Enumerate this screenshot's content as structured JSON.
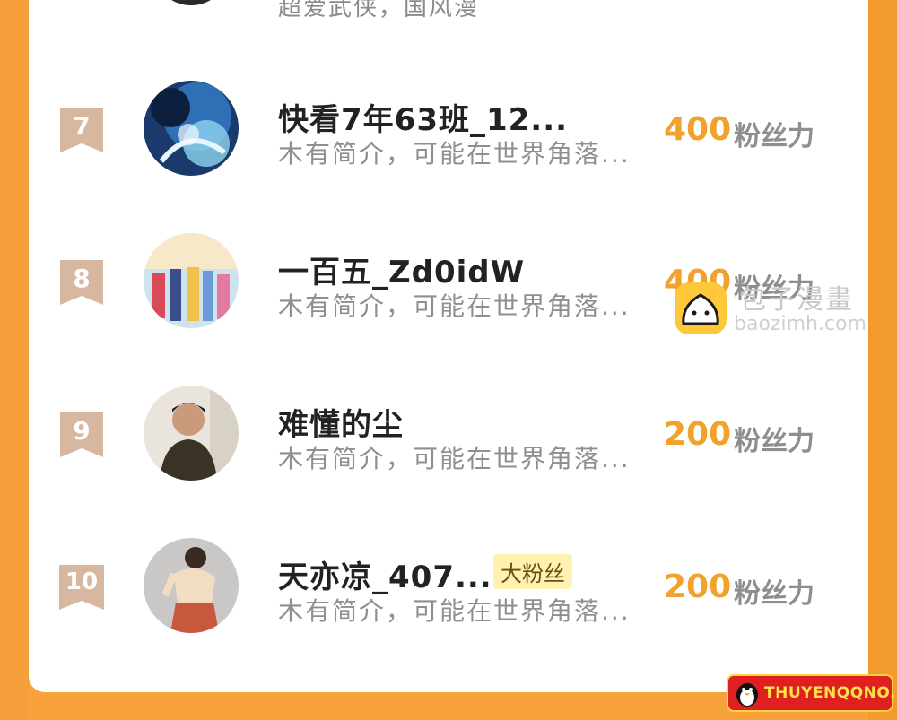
{
  "top_partial": {
    "desc": "超爱武侠，国风漫"
  },
  "rows": [
    {
      "rank": "7",
      "name": "快看7年63班_12...",
      "desc": "木有简介，可能在世界角落...",
      "score": "400",
      "unit": "粉丝力",
      "badge": ""
    },
    {
      "rank": "8",
      "name": "一百五_Zd0idW",
      "desc": "木有简介，可能在世界角落...",
      "score": "400",
      "unit": "粉丝力",
      "badge": ""
    },
    {
      "rank": "9",
      "name": "难懂的尘",
      "desc": "木有简介，可能在世界角落...",
      "score": "200",
      "unit": "粉丝力",
      "badge": ""
    },
    {
      "rank": "10",
      "name": "天亦凉_407...",
      "desc": "木有简介，可能在世界角落...",
      "score": "200",
      "unit": "粉丝力",
      "badge": "大粉丝"
    }
  ],
  "watermark": {
    "title": "包子漫畫",
    "url": "baozimh.com"
  },
  "site_tag": {
    "text": "THUYENQQNO.COM"
  },
  "colors": {
    "accent": "#f2a12c",
    "background": "#f7a23a",
    "rank_badge": "#d8b7a0",
    "badge_bg": "#fff1b0"
  }
}
